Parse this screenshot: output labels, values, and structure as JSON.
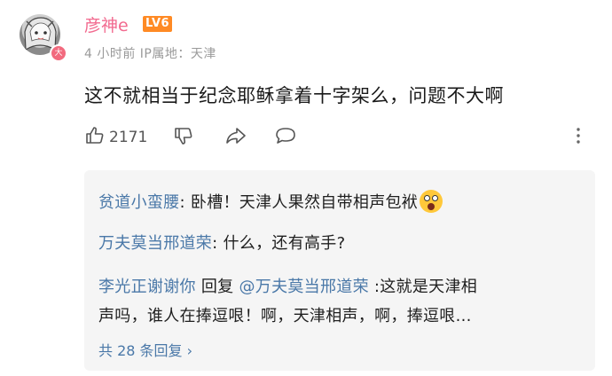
{
  "comment": {
    "username": "彦神e",
    "level": "LV6",
    "avatar_badge": "大",
    "meta": "4 小时前  IP属地：天津",
    "text": "这不就相当于纪念耶稣拿着十字架么，问题不大啊",
    "like_count": "2171"
  },
  "replies": [
    {
      "name": "贫道小蛮腰",
      "sep": ": ",
      "text": "卧槽！天津人果然自带相声包袱",
      "emoji": "astonished-emoji"
    },
    {
      "name": "万夫莫当邢道荣",
      "sep": ": ",
      "text": "什么，还有高手?"
    },
    {
      "name": "李光正谢谢你",
      "mid": " 回复 ",
      "at": "@万夫莫当邢道荣",
      "text": " :这就是天津相",
      "text2": "声吗，谁人在捧逗哏！啊，天津相声，啊，捧逗哏..."
    }
  ],
  "total_replies": "共 28 条回复 ›",
  "colors": {
    "username": "#f26a8f",
    "level": "#ff8a24",
    "link": "#4a78a8"
  }
}
